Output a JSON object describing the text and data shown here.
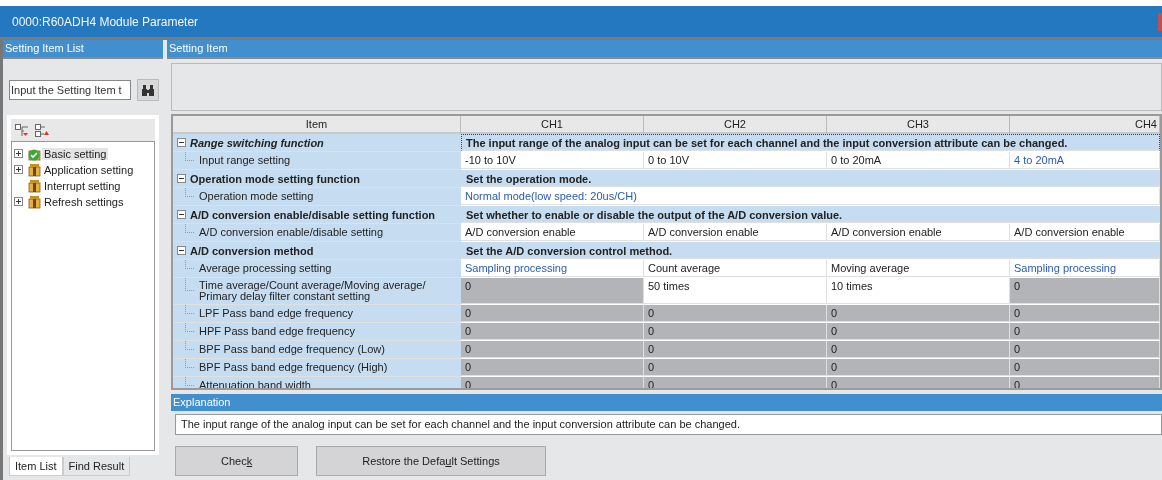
{
  "window": {
    "title": "0000:R60ADH4 Module Parameter"
  },
  "left_panel": {
    "title": "Setting Item List",
    "search": {
      "placeholder": "Input the Setting Item t"
    },
    "tree": [
      {
        "label": "Basic setting",
        "collapsible": true,
        "completed": true,
        "selected": true
      },
      {
        "label": "Application setting",
        "collapsible": true,
        "completed": false,
        "selected": false
      },
      {
        "label": "Interrupt setting",
        "collapsible": false,
        "completed": false,
        "selected": false
      },
      {
        "label": "Refresh settings",
        "collapsible": true,
        "completed": false,
        "selected": false
      }
    ],
    "tabs": [
      {
        "label": "Item List",
        "selected": true
      },
      {
        "label": "Find Result",
        "selected": false
      }
    ]
  },
  "right_panel": {
    "title": "Setting Item",
    "table": {
      "columns": [
        "Item",
        "CH1",
        "CH2",
        "CH3",
        "CH4"
      ],
      "groups": [
        {
          "title": "Range switching function",
          "italic": true,
          "expanded": true,
          "focused": true,
          "description": "The input range of the analog input can be set for each channel and the input conversion attribute can be changed.",
          "items": [
            {
              "label": "Input range setting",
              "kind": "per_channel",
              "cells": [
                {
                  "value": "-10 to 10V",
                  "changed": false,
                  "disabled": false
                },
                {
                  "value": "0 to 10V",
                  "changed": false,
                  "disabled": false
                },
                {
                  "value": "0 to 20mA",
                  "changed": false,
                  "disabled": false
                },
                {
                  "value": "4 to 20mA",
                  "changed": true,
                  "disabled": false
                }
              ]
            }
          ]
        },
        {
          "title": "Operation mode setting function",
          "italic": false,
          "expanded": true,
          "focused": false,
          "description": "Set the operation mode.",
          "items": [
            {
              "label": "Operation mode setting",
              "kind": "shared",
              "cells": [
                {
                  "value": "Normal mode(low speed: 20us/CH)",
                  "changed": true,
                  "disabled": false
                }
              ]
            }
          ]
        },
        {
          "title": "A/D conversion enable/disable setting function",
          "italic": false,
          "expanded": true,
          "focused": false,
          "description": "Set whether to enable or disable the output of the A/D conversion value.",
          "items": [
            {
              "label": "A/D conversion enable/disable setting",
              "kind": "per_channel",
              "cells": [
                {
                  "value": "A/D conversion enable",
                  "changed": false,
                  "disabled": false
                },
                {
                  "value": "A/D conversion enable",
                  "changed": false,
                  "disabled": false
                },
                {
                  "value": "A/D conversion enable",
                  "changed": false,
                  "disabled": false
                },
                {
                  "value": "A/D conversion enable",
                  "changed": false,
                  "disabled": false
                }
              ]
            }
          ]
        },
        {
          "title": "A/D conversion method",
          "italic": false,
          "expanded": true,
          "focused": false,
          "description": "Set the A/D conversion control method.",
          "items": [
            {
              "label": "Average processing setting",
              "kind": "per_channel",
              "cells": [
                {
                  "value": "Sampling processing",
                  "changed": true,
                  "disabled": false
                },
                {
                  "value": "Count average",
                  "changed": false,
                  "disabled": false
                },
                {
                  "value": "Moving average",
                  "changed": false,
                  "disabled": false
                },
                {
                  "value": "Sampling processing",
                  "changed": true,
                  "disabled": false
                }
              ]
            },
            {
              "label": "Time average/Count average/Moving average/\nPrimary delay filter constant setting",
              "kind": "per_channel",
              "cells": [
                {
                  "value": "0",
                  "changed": false,
                  "disabled": true
                },
                {
                  "value": "50 times",
                  "changed": false,
                  "disabled": false
                },
                {
                  "value": "10 times",
                  "changed": false,
                  "disabled": false
                },
                {
                  "value": "0",
                  "changed": false,
                  "disabled": true
                }
              ]
            },
            {
              "label": "LPF Pass band edge frequency",
              "kind": "per_channel",
              "cells": [
                {
                  "value": "0",
                  "changed": false,
                  "disabled": true
                },
                {
                  "value": "0",
                  "changed": false,
                  "disabled": true
                },
                {
                  "value": "0",
                  "changed": false,
                  "disabled": true
                },
                {
                  "value": "0",
                  "changed": false,
                  "disabled": true
                }
              ]
            },
            {
              "label": "HPF Pass band edge frequency",
              "kind": "per_channel",
              "cells": [
                {
                  "value": "0",
                  "changed": false,
                  "disabled": true
                },
                {
                  "value": "0",
                  "changed": false,
                  "disabled": true
                },
                {
                  "value": "0",
                  "changed": false,
                  "disabled": true
                },
                {
                  "value": "0",
                  "changed": false,
                  "disabled": true
                }
              ]
            },
            {
              "label": "BPF Pass band edge frequency (Low)",
              "kind": "per_channel",
              "cells": [
                {
                  "value": "0",
                  "changed": false,
                  "disabled": true
                },
                {
                  "value": "0",
                  "changed": false,
                  "disabled": true
                },
                {
                  "value": "0",
                  "changed": false,
                  "disabled": true
                },
                {
                  "value": "0",
                  "changed": false,
                  "disabled": true
                }
              ]
            },
            {
              "label": "BPF Pass band edge frequency (High)",
              "kind": "per_channel",
              "cells": [
                {
                  "value": "0",
                  "changed": false,
                  "disabled": true
                },
                {
                  "value": "0",
                  "changed": false,
                  "disabled": true
                },
                {
                  "value": "0",
                  "changed": false,
                  "disabled": true
                },
                {
                  "value": "0",
                  "changed": false,
                  "disabled": true
                }
              ]
            },
            {
              "label": "Attenuation band width",
              "kind": "per_channel",
              "cells": [
                {
                  "value": "0",
                  "changed": false,
                  "disabled": true
                },
                {
                  "value": "0",
                  "changed": false,
                  "disabled": true
                },
                {
                  "value": "0",
                  "changed": false,
                  "disabled": true
                },
                {
                  "value": "0",
                  "changed": false,
                  "disabled": true
                }
              ]
            }
          ]
        }
      ]
    },
    "explanation": {
      "title": "Explanation",
      "text": "The input range of the analog input can be set for each channel and the input conversion attribute can be changed."
    },
    "buttons": [
      {
        "before": "Chec",
        "key": "k"
      },
      {
        "before": "Restore the Defa",
        "key": "u",
        "after": "lt Settings"
      }
    ]
  }
}
